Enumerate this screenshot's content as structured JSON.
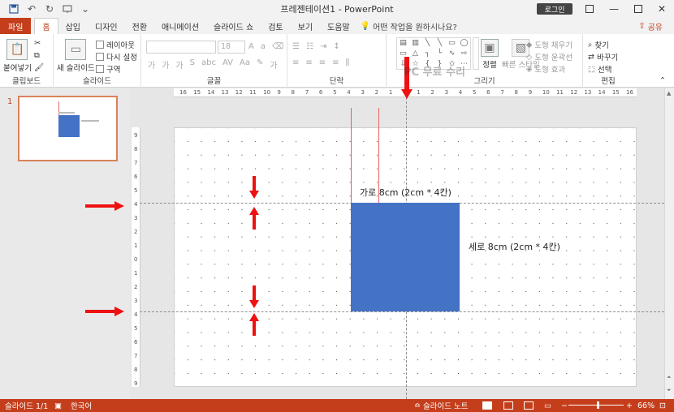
{
  "window": {
    "doc_title": "프레젠테이션1 - PowerPoint",
    "login_label": "로그인",
    "min_icon": "minimize-icon",
    "max_icon": "maximize-icon",
    "close_icon": "close-icon"
  },
  "tabs": {
    "file": "파일",
    "home": "홈",
    "insert": "삽입",
    "design": "디자인",
    "transitions": "전환",
    "animations": "애니메이션",
    "slideshow": "슬라이드 쇼",
    "review": "검토",
    "view": "보기",
    "help": "도움말",
    "tellme": "어떤 작업을 원하시나요?",
    "share": "공유"
  },
  "ribbon": {
    "clipboard": {
      "paste": "붙여넣기",
      "label": "클립보드"
    },
    "slides": {
      "new_slide": "새 슬라이드",
      "layout": "레이아웃",
      "reset": "다시 설정",
      "section": "구역",
      "label": "슬라이드"
    },
    "font": {
      "size": "18",
      "label": "글꼴"
    },
    "paragraph": {
      "label": "단락"
    },
    "drawing": {
      "arrange": "정렬",
      "quick_styles": "빠른 스타일",
      "shape_fill": "도형 채우기",
      "shape_outline": "도형 윤곽선",
      "shape_effects": "도형 효과",
      "label": "그리기"
    },
    "editing": {
      "find": "찾기",
      "replace": "바꾸기",
      "select": "선택",
      "label": "편집"
    }
  },
  "thumbnail": {
    "number": "1"
  },
  "rulers": {
    "horizontal": [
      "16",
      "15",
      "14",
      "13",
      "12",
      "11",
      "10",
      "9",
      "8",
      "7",
      "6",
      "5",
      "4",
      "3",
      "2",
      "1",
      "0",
      "1",
      "2",
      "3",
      "4",
      "5",
      "6",
      "7",
      "8",
      "9",
      "10",
      "11",
      "12",
      "13",
      "14",
      "15",
      "16"
    ],
    "vertical": [
      "9",
      "8",
      "7",
      "6",
      "5",
      "4",
      "3",
      "2",
      "1",
      "0",
      "1",
      "2",
      "3",
      "4",
      "5",
      "6",
      "7",
      "8",
      "9"
    ]
  },
  "slide": {
    "width_label": "가로 8cm (2cm * 4칸)",
    "height_label": "세로 8cm (2cm * 4칸)",
    "box_color": "#4472C4",
    "guide_line_color": "#E8605F",
    "arrow_color": "#EE1111"
  },
  "status": {
    "slide_info": "슬라이드 1/1",
    "language": "한국어",
    "notes": "슬라이드 노트",
    "zoom": "66%"
  },
  "watermark": "PC 무료 수리"
}
